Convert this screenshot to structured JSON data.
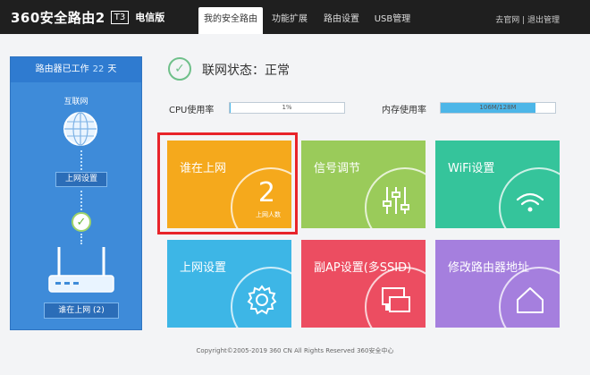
{
  "header": {
    "logo_text": "360安全路由2",
    "model_badge": "T3",
    "edition": "电信版",
    "tabs": [
      {
        "label": "我的安全路由",
        "active": true
      },
      {
        "label": "功能扩展",
        "active": false
      },
      {
        "label": "路由设置",
        "active": false
      },
      {
        "label": "USB管理",
        "active": false
      }
    ],
    "link_portal": "去官网",
    "link_separator": " | ",
    "link_logout": "退出管理"
  },
  "left_panel": {
    "uptime_prefix": "路由器已工作",
    "uptime_days": "22",
    "uptime_suffix": "天",
    "internet_label": "互联网",
    "internet_setup_button": "上网设置",
    "online_button": "谁在上网 (2)"
  },
  "status": {
    "title": "联网状态：正常",
    "cpu_label": "CPU使用率",
    "cpu_value": "1%",
    "cpu_fraction": 0.01,
    "mem_label": "内存使用率",
    "mem_value": "106M/128M",
    "mem_fraction": 0.83
  },
  "tiles": [
    {
      "label": "谁在上网",
      "color": "#f5a91c",
      "icon": "people-count",
      "count": "2",
      "count_label": "上网人数"
    },
    {
      "label": "信号调节",
      "color": "#9acb5a",
      "icon": "sliders-icon"
    },
    {
      "label": "WiFi设置",
      "color": "#35c49b",
      "icon": "wifi-icon"
    },
    {
      "label": "上网设置",
      "color": "#3db6e6",
      "icon": "gear-icon"
    },
    {
      "label": "副AP设置(多SSID)",
      "color": "#ec4d61",
      "icon": "multi-screen-icon"
    },
    {
      "label": "修改路由器地址",
      "color": "#a57fde",
      "icon": "home-icon"
    }
  ],
  "footer": {
    "copyright": "Copyright©2005-2019 360 CN All Rights Reserved 360安全中心"
  }
}
